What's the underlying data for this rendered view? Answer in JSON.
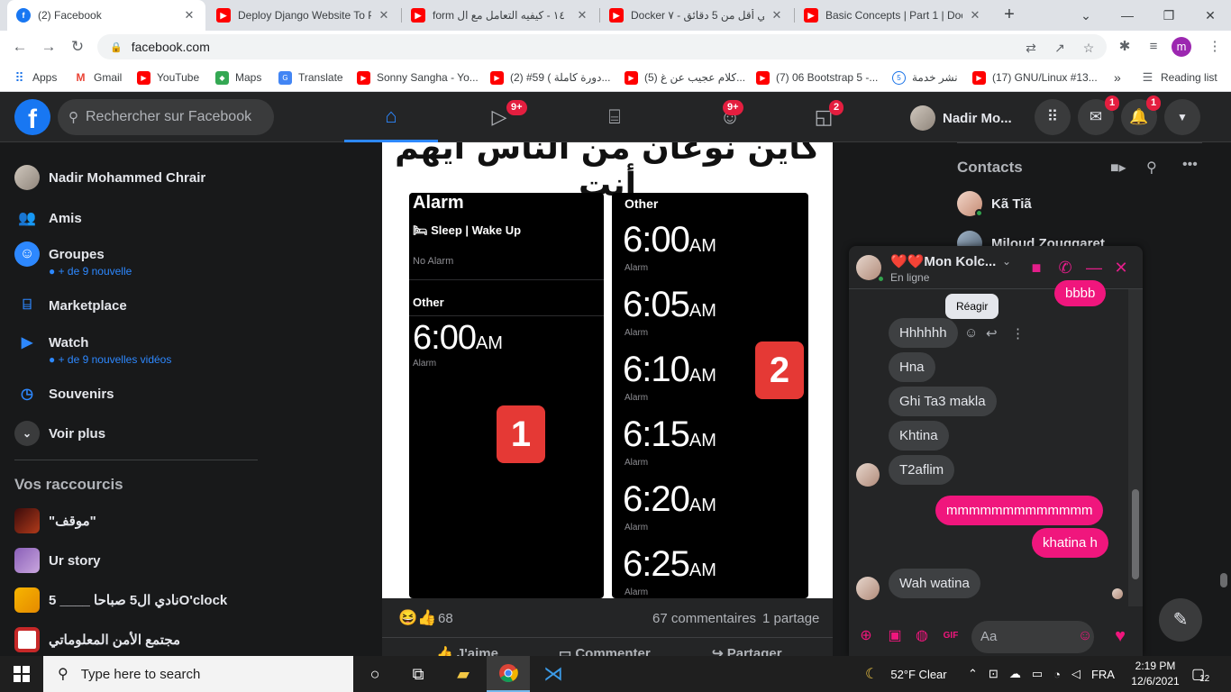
{
  "browser": {
    "tabs": [
      {
        "title": "(2) Facebook",
        "icon": "facebook-icon",
        "active": true
      },
      {
        "title": "Deploy Django Website To Py",
        "icon": "youtube-icon"
      },
      {
        "title": "form ١٤ - كيفيه التعامل مع ال",
        "icon": "youtube-icon"
      },
      {
        "title": "Docker في أقل من 5 دقائق - ٧",
        "icon": "youtube-icon"
      },
      {
        "title": "Basic Concepts | Part 1 | Doc",
        "icon": "youtube-icon"
      }
    ],
    "new_tab": "+",
    "url": "facebook.com",
    "profile_initial": "m",
    "bookmarks": [
      {
        "label": "Apps",
        "icon": "apps-grid-icon"
      },
      {
        "label": "Gmail",
        "icon": "gmail-icon"
      },
      {
        "label": "YouTube",
        "icon": "youtube-icon"
      },
      {
        "label": "Maps",
        "icon": "maps-icon"
      },
      {
        "label": "Translate",
        "icon": "translate-icon"
      },
      {
        "label": "Sonny Sangha - Yo...",
        "icon": "youtube-icon"
      },
      {
        "label": "(2) #59 ( دورة كاملة...",
        "icon": "youtube-icon"
      },
      {
        "label": "(5) كلام عجيب عن غ...",
        "icon": "youtube-icon"
      },
      {
        "label": "(7) 06 Bootstrap 5 -...",
        "icon": "youtube-icon"
      },
      {
        "label": "نشر خدمة",
        "icon": "khamsat-icon"
      },
      {
        "label": "(17) GNU/Linux #13...",
        "icon": "youtube-icon"
      }
    ],
    "more_bookmarks": "»",
    "reading_list": "Reading list"
  },
  "facebook": {
    "search_placeholder": "Rechercher sur Facebook",
    "nav": [
      {
        "name": "home",
        "badge": ""
      },
      {
        "name": "watch",
        "badge": "9+"
      },
      {
        "name": "marketplace",
        "badge": ""
      },
      {
        "name": "groups",
        "badge": "9+"
      },
      {
        "name": "gaming",
        "badge": "2"
      }
    ],
    "user_short": "Nadir Mo...",
    "messenger_badge": "1",
    "notifications_badge": "1"
  },
  "sidebar": {
    "profile": "Nadir Mohammed Chrair",
    "items": [
      {
        "label": "Amis",
        "sub": ""
      },
      {
        "label": "Groupes",
        "sub": "● + de 9 nouvelle"
      },
      {
        "label": "Marketplace",
        "sub": ""
      },
      {
        "label": "Watch",
        "sub": "● + de 9 nouvelles vidéos"
      },
      {
        "label": "Souvenirs",
        "sub": ""
      },
      {
        "label": "Voir plus",
        "sub": ""
      }
    ],
    "shortcuts_heading": "Vos raccourcis",
    "shortcuts": [
      {
        "label": "\"موقف\""
      },
      {
        "label": "Ur story"
      },
      {
        "label": "نادي ال5 صباحا ____ 5O'clock"
      },
      {
        "label": "مجتمع الأمن المعلوماتي"
      }
    ]
  },
  "post": {
    "caption_ar": "كاين نوعان من الناس أيهم أنت",
    "phone1": {
      "title": "Alarm",
      "sleep": "🛏 Sleep | Wake Up",
      "no_alarm": "No Alarm",
      "other": "Other",
      "time": "6:00",
      "ampm": "AM",
      "alarm_lbl": "Alarm",
      "number": "1"
    },
    "phone2": {
      "other": "Other",
      "times": [
        "6:00",
        "6:05",
        "6:10",
        "6:15",
        "6:20",
        "6:25"
      ],
      "ampm": "AM",
      "alarm_lbl": "Alarm",
      "number": "2"
    },
    "reactions_count": "68",
    "comments": "67 commentaires",
    "shares": "1 partage",
    "actions": [
      "J'aime",
      "Commenter",
      "Partager"
    ]
  },
  "contacts": {
    "heading": "Contacts",
    "list": [
      "Kã Tiã",
      "Miloud Zouggaret"
    ]
  },
  "chat": {
    "title": "❤️❤️Mon Kolc...",
    "status": "En ligne",
    "tooltip": "Réagir",
    "messages": [
      {
        "text": "bbbb",
        "dir": "out"
      },
      {
        "text": "Hhhhhh",
        "dir": "in"
      },
      {
        "text": "Hna",
        "dir": "in"
      },
      {
        "text": "Ghi Ta3 makla",
        "dir": "in"
      },
      {
        "text": "Khtina",
        "dir": "in"
      },
      {
        "text": "T2aflim",
        "dir": "in"
      },
      {
        "text": "mmmmmmmmmmmmm",
        "dir": "out"
      },
      {
        "text": "khatina h",
        "dir": "out"
      },
      {
        "text": "Wah watina",
        "dir": "in"
      }
    ],
    "input_placeholder": "Aa"
  },
  "taskbar": {
    "search_placeholder": "Type here to search",
    "weather": "52°F  Clear",
    "lang": "FRA",
    "time": "2:19 PM",
    "date": "12/6/2021",
    "notif_count": "12"
  }
}
